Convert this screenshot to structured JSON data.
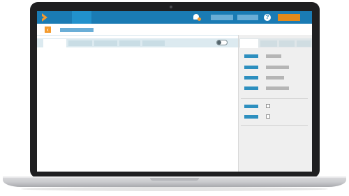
{
  "topbar": {
    "logo": "play-logo-icon",
    "notifications_icon": "bell-icon",
    "help_icon_text": "?"
  },
  "subheader": {
    "back_icon_text": "‹"
  },
  "colors": {
    "accent": "#1a7bb4",
    "brand_orange": "#f49a2d",
    "label_blue": "#2d8fbf"
  }
}
